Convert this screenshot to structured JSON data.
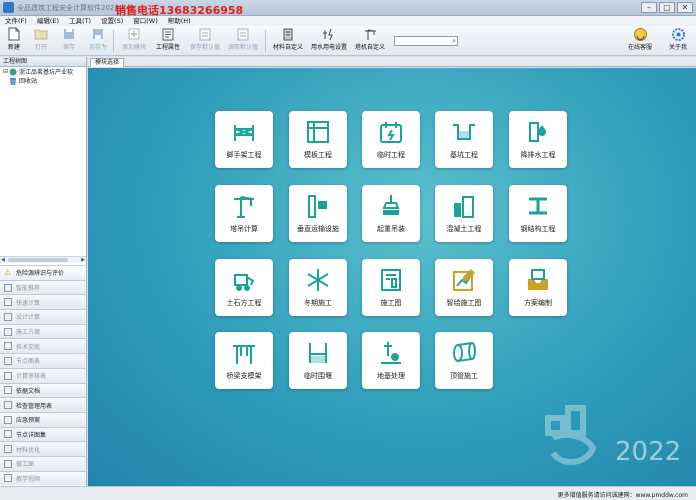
{
  "window": {
    "title": "全品建筑工程安全计算软件2022",
    "promo": "销售电话13683266958",
    "controls": [
      "–",
      "▢",
      "✕"
    ]
  },
  "menu": [
    "文件(F)",
    "编辑(E)",
    "工具(T)",
    "设置(S)",
    "窗口(W)",
    "帮助(H)"
  ],
  "toolbar": {
    "new": "新建",
    "open": "打开",
    "save": "保存",
    "save_as": "另存为",
    "add_module": "添加模块",
    "project_props": "工程属性",
    "save_default": "保存默认值",
    "load_default": "调取默认值",
    "material_custom": "材料自定义",
    "water_power": "用水用电设置",
    "tower_custom": "塔机自定义",
    "search_placeholder": "",
    "online_service": "在线客服",
    "about": "关于我"
  },
  "left_panel": {
    "header": "工程树图",
    "tree": [
      {
        "label": "浙江品茗基坑产业软"
      },
      {
        "label": "回收站"
      }
    ],
    "accordion": [
      {
        "label": "危险源辨识与评价",
        "muted": false
      },
      {
        "label": "智能推荐",
        "muted": true
      },
      {
        "label": "快速计算",
        "muted": true
      },
      {
        "label": "设计计算",
        "muted": true
      },
      {
        "label": "施工方案",
        "muted": true
      },
      {
        "label": "技术交底",
        "muted": true
      },
      {
        "label": "节点图表",
        "muted": true
      },
      {
        "label": "计算审核表",
        "muted": true
      },
      {
        "label": "依据文档",
        "muted": false
      },
      {
        "label": "检查管理用表",
        "muted": false
      },
      {
        "label": "应急预案",
        "muted": false
      },
      {
        "label": "节点详图集",
        "muted": false
      },
      {
        "label": "材料优化",
        "muted": true
      },
      {
        "label": "做工图",
        "muted": true
      },
      {
        "label": "教学视频",
        "muted": true
      }
    ]
  },
  "tab": "模块选择",
  "modules": [
    {
      "label": "脚手架工程",
      "icon": "scaffold-icon"
    },
    {
      "label": "模板工程",
      "icon": "formwork-icon"
    },
    {
      "label": "临时工程",
      "icon": "temporary-works-icon"
    },
    {
      "label": "基坑工程",
      "icon": "foundation-pit-icon"
    },
    {
      "label": "降排水工程",
      "icon": "dewatering-icon"
    },
    {
      "label": "塔吊计算",
      "icon": "tower-crane-icon"
    },
    {
      "label": "垂直运输设施",
      "icon": "hoist-icon"
    },
    {
      "label": "起重吊装",
      "icon": "lifting-icon"
    },
    {
      "label": "混凝土工程",
      "icon": "concrete-icon"
    },
    {
      "label": "钢结构工程",
      "icon": "steel-beam-icon"
    },
    {
      "label": "土石方工程",
      "icon": "earthwork-icon"
    },
    {
      "label": "冬期施工",
      "icon": "snowflake-icon"
    },
    {
      "label": "施工图",
      "icon": "drawing-icon"
    },
    {
      "label": "智绘施工图",
      "icon": "smart-drawing-icon"
    },
    {
      "label": "方案编制",
      "icon": "plan-tray-icon"
    },
    {
      "label": "桥梁支模架",
      "icon": "bridge-support-icon"
    },
    {
      "label": "临时围堰",
      "icon": "cofferdam-icon"
    },
    {
      "label": "地基处理",
      "icon": "ground-treatment-icon"
    },
    {
      "label": "顶管施工",
      "icon": "pipe-jacking-icon"
    }
  ],
  "brand_year": "2022",
  "status": "更多增值服务请访问诚建网：www.pmddw.com",
  "colors": {
    "accent": "#1aa39a",
    "promo": "#e3201b",
    "bg_top": "#5ac0cd",
    "bg_bottom": "#2285ab"
  }
}
